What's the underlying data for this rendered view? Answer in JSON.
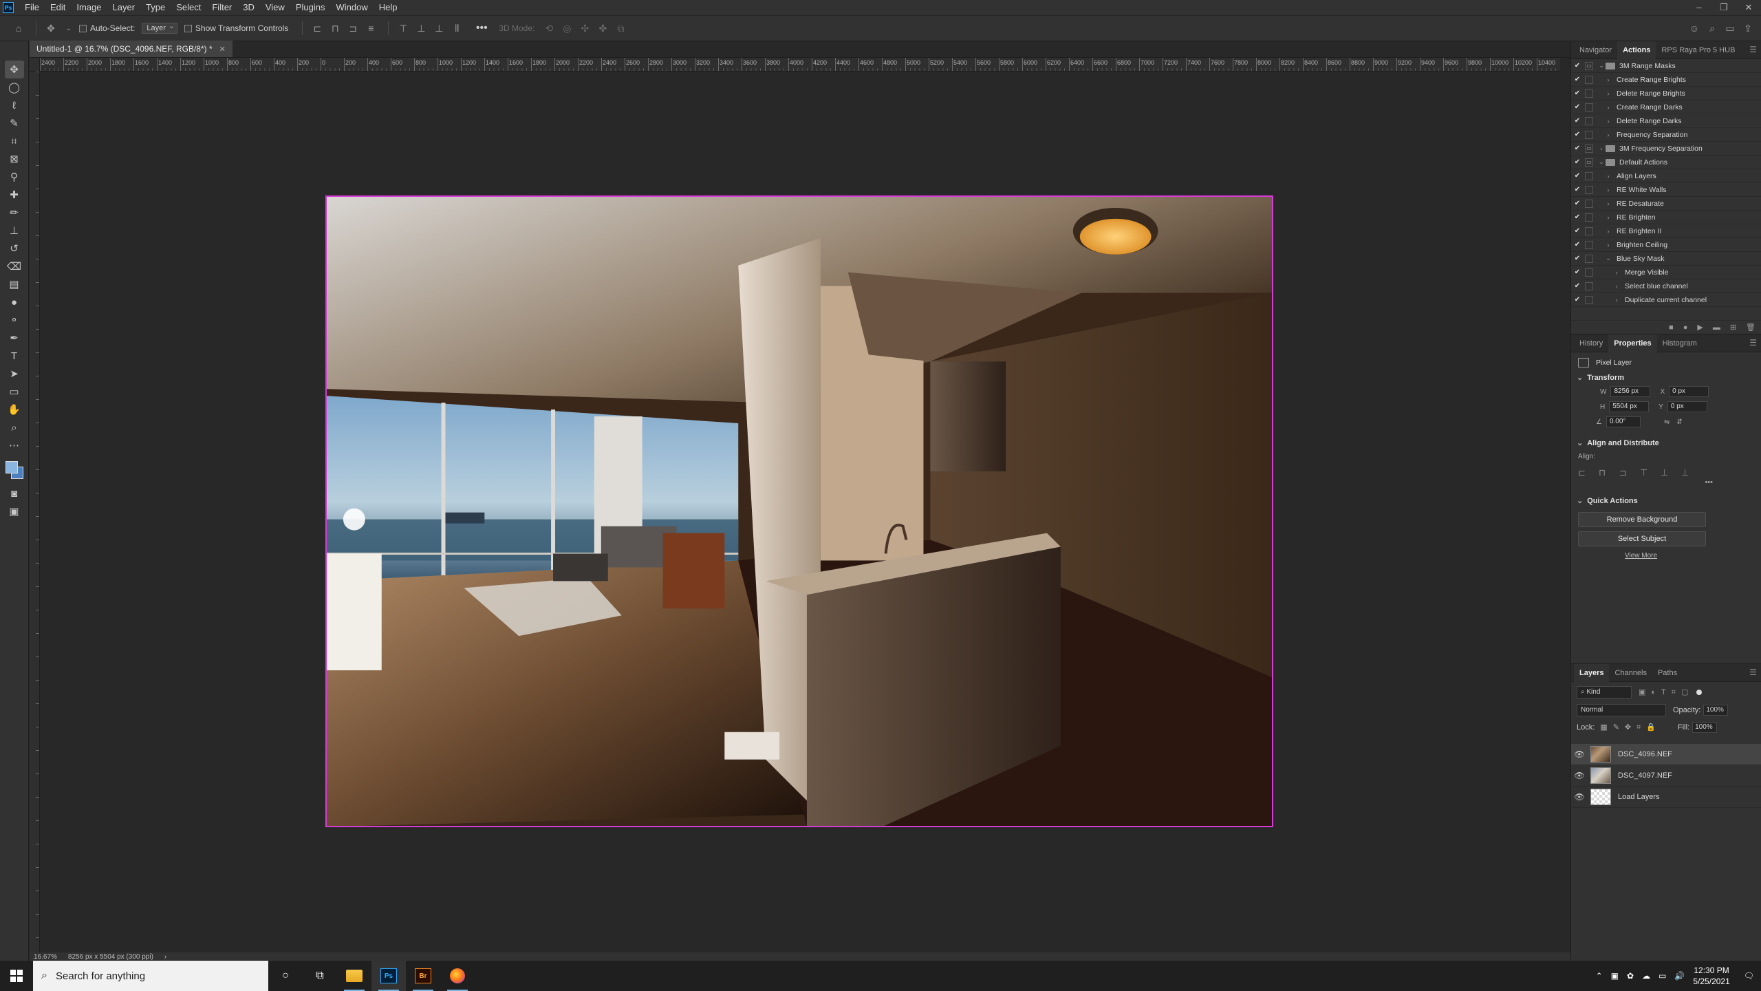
{
  "menu": [
    "File",
    "Edit",
    "Image",
    "Layer",
    "Type",
    "Select",
    "Filter",
    "3D",
    "View",
    "Plugins",
    "Window",
    "Help"
  ],
  "options": {
    "auto_select": "Auto-Select:",
    "layer_dropdown": "Layer",
    "show_transform": "Show Transform Controls",
    "mode_3d": "3D Mode:"
  },
  "document": {
    "tab_title": "Untitled-1 @ 16.7% (DSC_4096.NEF, RGB/8*) *"
  },
  "ruler_ticks": [
    "2400",
    "2200",
    "2000",
    "1800",
    "1600",
    "1400",
    "1200",
    "1000",
    "800",
    "600",
    "400",
    "200",
    "0",
    "200",
    "400",
    "600",
    "800",
    "1000",
    "1200",
    "1400",
    "1600",
    "1800",
    "2000",
    "2200",
    "2400",
    "2600",
    "2800",
    "3000",
    "3200",
    "3400",
    "3600",
    "3800",
    "4000",
    "4200",
    "4400",
    "4600",
    "4800",
    "5000",
    "5200",
    "5400",
    "5600",
    "5800",
    "6000",
    "6200",
    "6400",
    "6600",
    "6800",
    "7000",
    "7200",
    "7400",
    "7600",
    "7800",
    "8000",
    "8200",
    "8400",
    "8600",
    "8800",
    "9000",
    "9200",
    "9400",
    "9600",
    "9800",
    "10000",
    "10200",
    "10400",
    "10600"
  ],
  "status": {
    "zoom": "16.67%",
    "doc_size": "8256 px x 5504 px (300 ppi)"
  },
  "panels": {
    "top_tabs": [
      "Navigator",
      "Actions",
      "RPS Raya Pro 5 HUB"
    ],
    "actions": [
      {
        "name": "3M Range Masks",
        "level": 0,
        "set": true,
        "open": true
      },
      {
        "name": "Create Range Brights",
        "level": 1
      },
      {
        "name": "Delete Range Brights",
        "level": 1
      },
      {
        "name": "Create Range Darks",
        "level": 1
      },
      {
        "name": "Delete Range Darks",
        "level": 1
      },
      {
        "name": "Frequency Separation",
        "level": 1
      },
      {
        "name": "3M Frequency Separation",
        "level": 0,
        "set": true
      },
      {
        "name": "Default Actions",
        "level": 0,
        "set": true,
        "open": true
      },
      {
        "name": "Align Layers",
        "level": 1
      },
      {
        "name": "RE White Walls",
        "level": 1
      },
      {
        "name": "RE Desaturate",
        "level": 1
      },
      {
        "name": "RE Brighten",
        "level": 1
      },
      {
        "name": "RE Brighten II",
        "level": 1
      },
      {
        "name": "Brighten Ceiling",
        "level": 1
      },
      {
        "name": "Blue Sky Mask",
        "level": 1,
        "open": true
      },
      {
        "name": "Merge Visible",
        "level": 2
      },
      {
        "name": "Select blue channel",
        "level": 2
      },
      {
        "name": "Duplicate current channel",
        "level": 2
      }
    ],
    "mid_tabs": [
      "History",
      "Properties",
      "Histogram"
    ],
    "properties": {
      "type": "Pixel Layer",
      "transform_label": "Transform",
      "w_label": "W",
      "w": "8256 px",
      "x_label": "X",
      "x": "0 px",
      "h_label": "H",
      "h": "5504 px",
      "y_label": "Y",
      "y": "0 px",
      "angle": "0.00°",
      "align_label": "Align and Distribute",
      "align_sub": "Align:",
      "quick_label": "Quick Actions",
      "remove_bg": "Remove Background",
      "select_subject": "Select Subject",
      "view_more": "View More"
    },
    "layer_tabs": [
      "Layers",
      "Channels",
      "Paths"
    ],
    "layers_opts": {
      "kind": "Kind",
      "blend": "Normal",
      "opacity_label": "Opacity:",
      "opacity": "100%",
      "lock_label": "Lock:",
      "fill_label": "Fill:",
      "fill": "100%"
    },
    "layers": [
      {
        "name": "DSC_4096.NEF",
        "selected": true
      },
      {
        "name": "DSC_4097.NEF",
        "selected": false
      },
      {
        "name": "Load Layers",
        "selected": false
      }
    ]
  },
  "taskbar": {
    "search_placeholder": "Search for anything",
    "time": "12:30 PM",
    "date": "5/25/2021"
  }
}
